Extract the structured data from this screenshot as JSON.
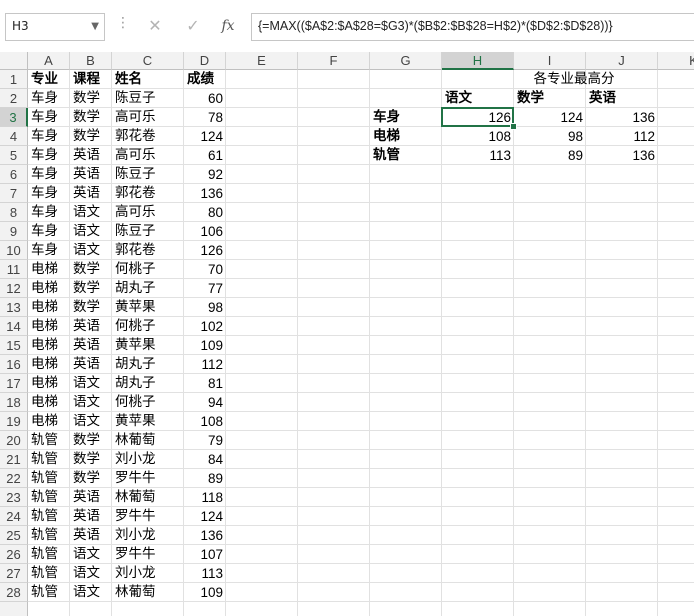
{
  "toolbar": {
    "name_box": "H3",
    "more_icon": "⋮",
    "cancel_icon": "✕",
    "enter_icon": "✓",
    "fx_icon": "fx",
    "formula": "{=MAX(($A$2:$A$28=$G3)*($B$2:$B$28=H$2)*($D$2:$D$28))}"
  },
  "columns": [
    "A",
    "B",
    "C",
    "D",
    "E",
    "F",
    "G",
    "H",
    "I",
    "J",
    "K"
  ],
  "selected_cell": "H3",
  "source_table": {
    "headers": [
      "专业",
      "课程",
      "姓名",
      "成绩"
    ],
    "rows": [
      [
        "车身",
        "数学",
        "陈豆子",
        60
      ],
      [
        "车身",
        "数学",
        "高可乐",
        78
      ],
      [
        "车身",
        "数学",
        "郭花卷",
        124
      ],
      [
        "车身",
        "英语",
        "高可乐",
        61
      ],
      [
        "车身",
        "英语",
        "陈豆子",
        92
      ],
      [
        "车身",
        "英语",
        "郭花卷",
        136
      ],
      [
        "车身",
        "语文",
        "高可乐",
        80
      ],
      [
        "车身",
        "语文",
        "陈豆子",
        106
      ],
      [
        "车身",
        "语文",
        "郭花卷",
        126
      ],
      [
        "电梯",
        "数学",
        "何桃子",
        70
      ],
      [
        "电梯",
        "数学",
        "胡丸子",
        77
      ],
      [
        "电梯",
        "数学",
        "黄苹果",
        98
      ],
      [
        "电梯",
        "英语",
        "何桃子",
        102
      ],
      [
        "电梯",
        "英语",
        "黄苹果",
        109
      ],
      [
        "电梯",
        "英语",
        "胡丸子",
        112
      ],
      [
        "电梯",
        "语文",
        "胡丸子",
        81
      ],
      [
        "电梯",
        "语文",
        "何桃子",
        94
      ],
      [
        "电梯",
        "语文",
        "黄苹果",
        108
      ],
      [
        "轨管",
        "数学",
        "林葡萄",
        79
      ],
      [
        "轨管",
        "数学",
        "刘小龙",
        84
      ],
      [
        "轨管",
        "数学",
        "罗牛牛",
        89
      ],
      [
        "轨管",
        "英语",
        "林葡萄",
        118
      ],
      [
        "轨管",
        "英语",
        "罗牛牛",
        124
      ],
      [
        "轨管",
        "英语",
        "刘小龙",
        136
      ],
      [
        "轨管",
        "语文",
        "罗牛牛",
        107
      ],
      [
        "轨管",
        "语文",
        "刘小龙",
        113
      ],
      [
        "轨管",
        "语文",
        "林葡萄",
        109
      ]
    ]
  },
  "summary_table": {
    "title": "各专业最高分",
    "subjects": [
      "语文",
      "数学",
      "英语"
    ],
    "rows": [
      {
        "major": "车身",
        "values": [
          126,
          124,
          136
        ]
      },
      {
        "major": "电梯",
        "values": [
          108,
          98,
          112
        ]
      },
      {
        "major": "轨管",
        "values": [
          113,
          89,
          136
        ]
      }
    ]
  },
  "colors": {
    "accent": "#217346"
  }
}
